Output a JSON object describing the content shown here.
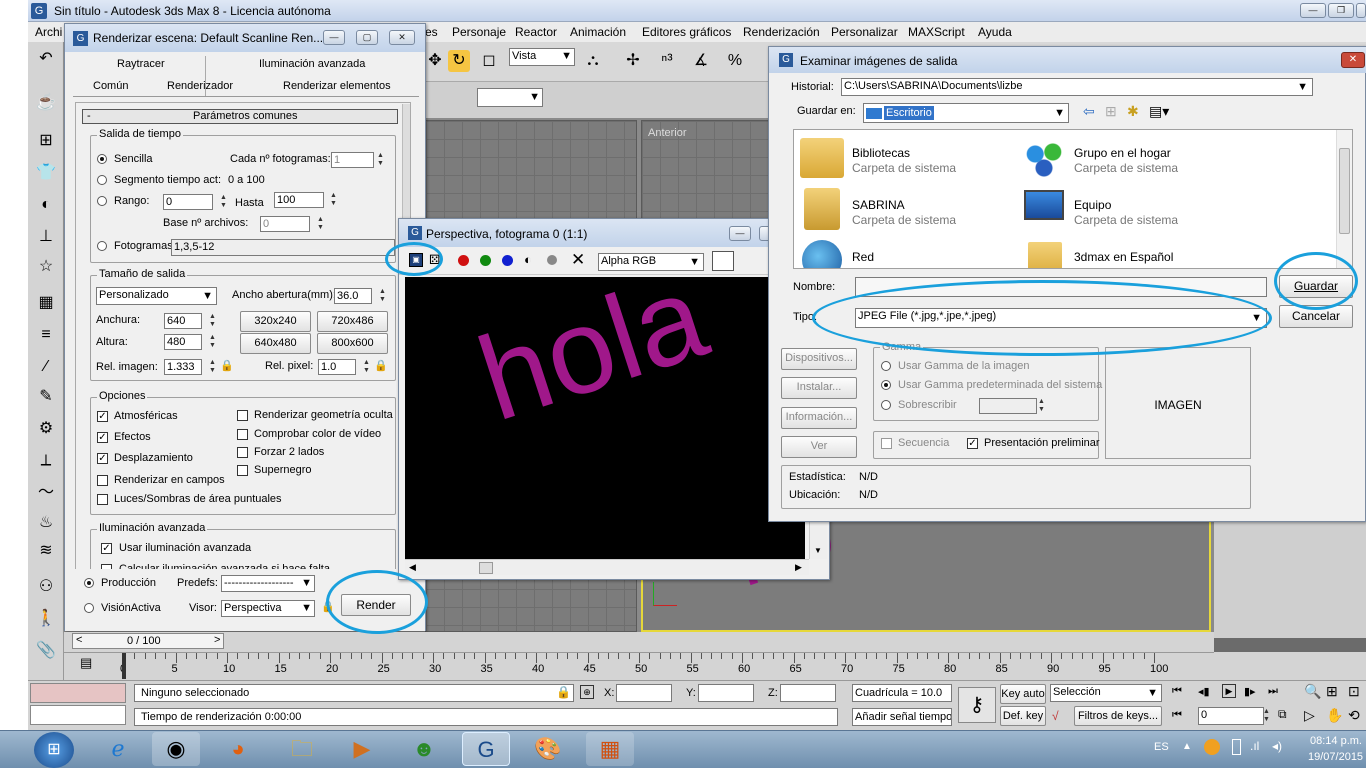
{
  "app": {
    "title": "Sin título - Autodesk 3ds Max 8  - Licencia autónoma",
    "menu": [
      "Archi",
      "es",
      "Personaje",
      "Reactor",
      "Animación",
      "Editores gráficos",
      "Renderización",
      "Personalizar",
      "MAXScript",
      "Ayuda"
    ],
    "toolbar_view_select": "Vista",
    "viewport_label": "Anterior"
  },
  "render_dialog": {
    "title": "Renderizar escena: Default Scanline Ren...",
    "tabs_row1": [
      "Raytracer",
      "Iluminación avanzada"
    ],
    "tabs_row2": [
      "Común",
      "Renderizador",
      "Renderizar elementos"
    ],
    "rollout_sign": "-",
    "rollout_title": "Parámetros comunes",
    "time_group": "Salida de tiempo",
    "sencilla": "Sencilla",
    "cada_label": "Cada nº fotogramas:",
    "cada_value": "1",
    "segmento": "Segmento tiempo act:",
    "segmento_range": "0 a 100",
    "rango": "Rango:",
    "rango_from": "0",
    "hasta": "Hasta",
    "rango_to": "100",
    "base_label": "Base nº archivos:",
    "base_value": "0",
    "fotogramas": "Fotogramas",
    "fotogramas_value": "1,3,5-12",
    "size_group": "Tamaño de salida",
    "size_preset": "Personalizado",
    "aperture_label": "Ancho abertura(mm):",
    "aperture_value": "36.0",
    "width_label": "Anchura:",
    "width_value": "640",
    "height_label": "Altura:",
    "height_value": "480",
    "presets": [
      "320x240",
      "720x486",
      "640x480",
      "800x600"
    ],
    "ratio_label": "Rel. imagen:",
    "ratio_value": "1.333",
    "pixel_label": "Rel. pixel:",
    "pixel_value": "1.0",
    "options_group": "Opciones",
    "options_left": [
      "Atmosféricas",
      "Efectos",
      "Desplazamiento",
      "Renderizar en campos",
      "Luces/Sombras de área puntuales"
    ],
    "options_right": [
      "Renderizar geometría oculta",
      "Comprobar color de vídeo",
      "Forzar 2 lados",
      "Supernegro"
    ],
    "adv_group": "Iluminación avanzada",
    "adv_use": "Usar iluminación avanzada",
    "adv_calc": "Calcular iluminación avanzada si hace falta",
    "produccion": "Producción",
    "predefs_label": "Predefs:",
    "predefs_value": "-------------------",
    "visionactiva": "VisiónActiva",
    "visor_label": "Visor:",
    "visor_value": "Perspectiva",
    "render_button": "Render"
  },
  "frame_window": {
    "title": "Perspectiva, fotograma 0 (1:1)",
    "channel": "Alpha RGB",
    "render_text": "hola",
    "text_color": "#a0188a"
  },
  "file_dialog": {
    "title": "Examinar imágenes de salida",
    "historial_label": "Historial:",
    "historial_value": "C:\\Users\\SABRINA\\Documents\\lizbe",
    "guardar_en_label": "Guardar en:",
    "guardar_en_value": "Escritorio",
    "items": [
      {
        "name": "Bibliotecas",
        "desc": "Carpeta de sistema",
        "icon": "libraries-icon"
      },
      {
        "name": "Grupo en el hogar",
        "desc": "Carpeta de sistema",
        "icon": "homegroup-icon"
      },
      {
        "name": "SABRINA",
        "desc": "Carpeta de sistema",
        "icon": "user-folder-icon"
      },
      {
        "name": "Equipo",
        "desc": "Carpeta de sistema",
        "icon": "computer-icon"
      },
      {
        "name": "Red",
        "desc": "",
        "icon": "network-icon"
      },
      {
        "name": "3dmax en Español",
        "desc": "",
        "icon": "folder-icon"
      }
    ],
    "nombre_label": "Nombre:",
    "nombre_value": "",
    "tipo_label": "Tipo:",
    "tipo_value": "JPEG File (*.jpg,*.jpe,*.jpeg)",
    "guardar_button": "Guardar",
    "cancelar_button": "Cancelar",
    "side_buttons": [
      "Dispositivos...",
      "Instalar...",
      "Información...",
      "Ver"
    ],
    "gamma_group": "Gamma",
    "gamma_options": [
      "Usar Gamma de la imagen",
      "Usar Gamma predeterminada del sistema",
      "Sobrescribir"
    ],
    "secuencia": "Secuencia",
    "preview": "Presentación preliminar",
    "image_placeholder": "IMAGEN",
    "stats_label": "Estadística:",
    "stats_value": "N/D",
    "location_label": "Ubicación:",
    "location_value": "N/D"
  },
  "timeline": {
    "frame_counter": "0 / 100",
    "ticks": [
      "0",
      "5",
      "10",
      "15",
      "20",
      "25",
      "30",
      "35",
      "40",
      "45",
      "50",
      "55",
      "60",
      "65",
      "70",
      "75",
      "80",
      "85",
      "90",
      "95",
      "100"
    ]
  },
  "status": {
    "selection": "Ninguno seleccionado",
    "render_time": "Tiempo de renderización  0:00:00",
    "x_label": "X:",
    "y_label": "Y:",
    "z_label": "Z:",
    "grid": "Cuadrícula = 10.0",
    "add_tag": "Añadir señal tiempo",
    "key_auto": "Key auto",
    "def_key": "Def. key",
    "selection_mode": "Selección",
    "key_filters": "Filtros de keys...",
    "frame_value": "0"
  },
  "taskbar": {
    "lang": "ES",
    "time": "08:14 p.m.",
    "date": "19/07/2015"
  }
}
